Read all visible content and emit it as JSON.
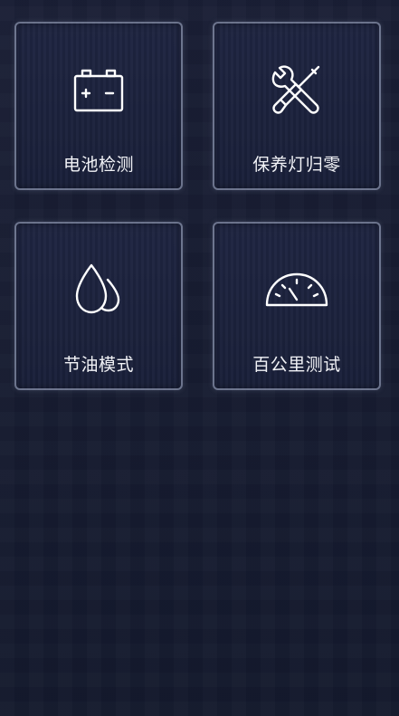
{
  "menu": {
    "items": [
      {
        "label": "电池检测",
        "icon": "battery-icon"
      },
      {
        "label": "保养灯归零",
        "icon": "wrench-screwdriver-icon"
      },
      {
        "label": "节油模式",
        "icon": "water-drops-icon"
      },
      {
        "label": "百公里测试",
        "icon": "speedometer-icon"
      }
    ]
  },
  "colors": {
    "background": "#161b30",
    "card_border": "#96a0b9",
    "text": "#f2f3f7",
    "icon_stroke": "#ffffff"
  }
}
